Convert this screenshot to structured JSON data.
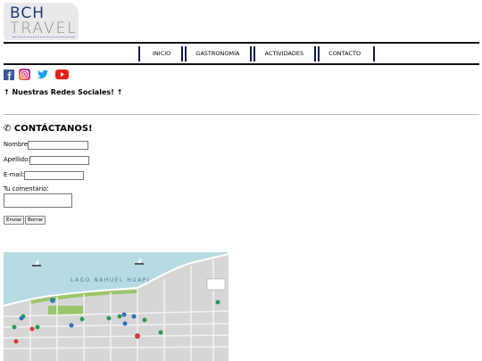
{
  "logo": {
    "line1": "BCH",
    "line2": "TRAVEL"
  },
  "nav": {
    "items": [
      "INICIO",
      "GASTRONOMÍA",
      "ACTIVIDADES",
      "CONTACTO"
    ]
  },
  "social": {
    "icons": [
      "facebook-icon",
      "instagram-icon",
      "twitter-icon",
      "youtube-icon"
    ]
  },
  "redes_text": "↑ Nuestras Redes Sociales! ↑",
  "contact": {
    "title": "✆ CONTÁCTANOS!",
    "nombre_label": "Nombre:",
    "apellido_label": "Apellido:",
    "email_label": "E-mail:",
    "comment_label": "Tu comentario:",
    "submit": "Enviar",
    "reset": "Borrar"
  },
  "map": {
    "lake_label": "LAGO NAHUEL HUAPI"
  },
  "colors": {
    "brand": "#1f3a7a",
    "nav_bar": "#101a4a",
    "lake": "#b6dbe5",
    "land": "#d6d6d6"
  }
}
